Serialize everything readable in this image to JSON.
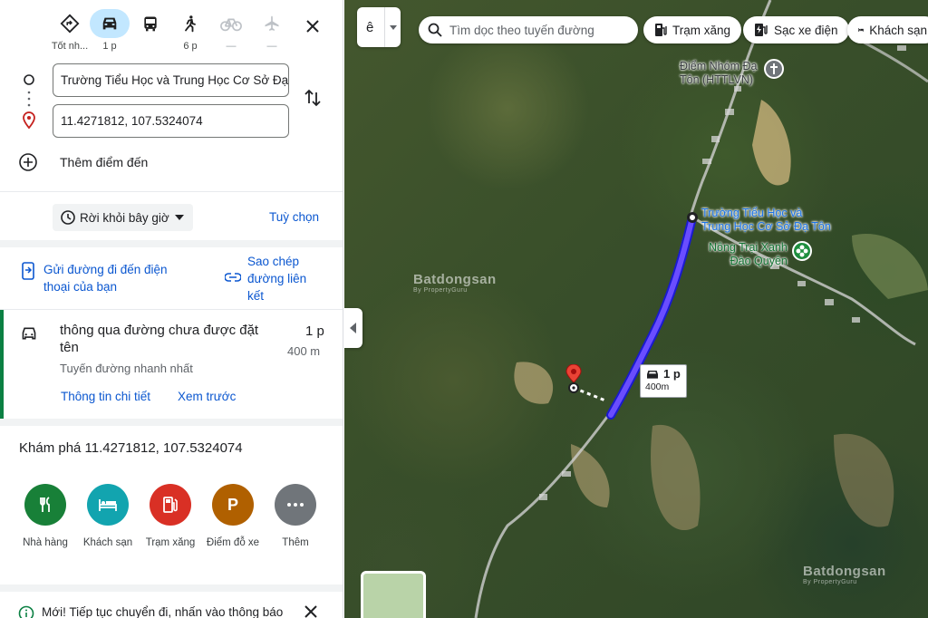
{
  "modes": [
    {
      "name": "Tốt nhất",
      "label": "Tốt nh..."
    },
    {
      "name": "Lái xe",
      "label": "1 p"
    },
    {
      "name": "Phương tiện công cộng",
      "label": ""
    },
    {
      "name": "Đi bộ",
      "label": "6 p"
    },
    {
      "name": "Xe đạp",
      "label": "—"
    },
    {
      "name": "Máy bay",
      "label": "—"
    }
  ],
  "route": {
    "origin": "Trường Tiểu Học và Trung Học Cơ Sở Đạ",
    "destination": "11.4271812, 107.5324074",
    "add_destination": "Thêm điểm đến",
    "depart": "Rời khỏi bây giờ",
    "options": "Tuỳ chọn"
  },
  "share": {
    "send_line1": "Gửi đường đi đến điện",
    "send_line2": "thoại của bạn",
    "copy_line1": "Sao chép",
    "copy_line2": "đường liên",
    "copy_line3": "kết"
  },
  "result": {
    "title": "thông qua đường chưa được đặt tên",
    "time": "1 p",
    "distance": "400 m",
    "subtitle": "Tuyến đường nhanh nhất",
    "details": "Thông tin chi tiết",
    "preview": "Xem trước"
  },
  "explore": {
    "title": "Khám phá 11.4271812, 107.5324074",
    "categories": [
      {
        "label": "Nhà hàng",
        "color": "#188038"
      },
      {
        "label": "Khách sạn",
        "color": "#12a4af"
      },
      {
        "label": "Trạm xăng",
        "color": "#d93025"
      },
      {
        "label": "Điểm đỗ xe",
        "color": "#b06000"
      },
      {
        "label": "Thêm",
        "color": "#70757a"
      }
    ]
  },
  "notice": {
    "text": "Mới! Tiếp tục chuyển đi, nhấn vào thông báo"
  },
  "map": {
    "lang": "ê",
    "search_placeholder": "Tìm dọc theo tuyến đường",
    "chips": [
      "Trạm xăng",
      "Sạc xe điện",
      "Khách sạn"
    ],
    "labels": {
      "poi1_line1": "Điểm Nhóm Đạ",
      "poi1_line2": "Tôn (HTTLVN)",
      "school_line1": "Trường Tiểu Học và",
      "school_line2": "Trung Học Cơ Sở Đạ Tôn",
      "farm_line1": "Nông Trại Xanh",
      "farm_line2": "Đào Quyên"
    },
    "callout_time": "1 p",
    "callout_dist": "400m",
    "watermark": "Batdongsan",
    "watermark_sub": "By PropertyGuru"
  }
}
